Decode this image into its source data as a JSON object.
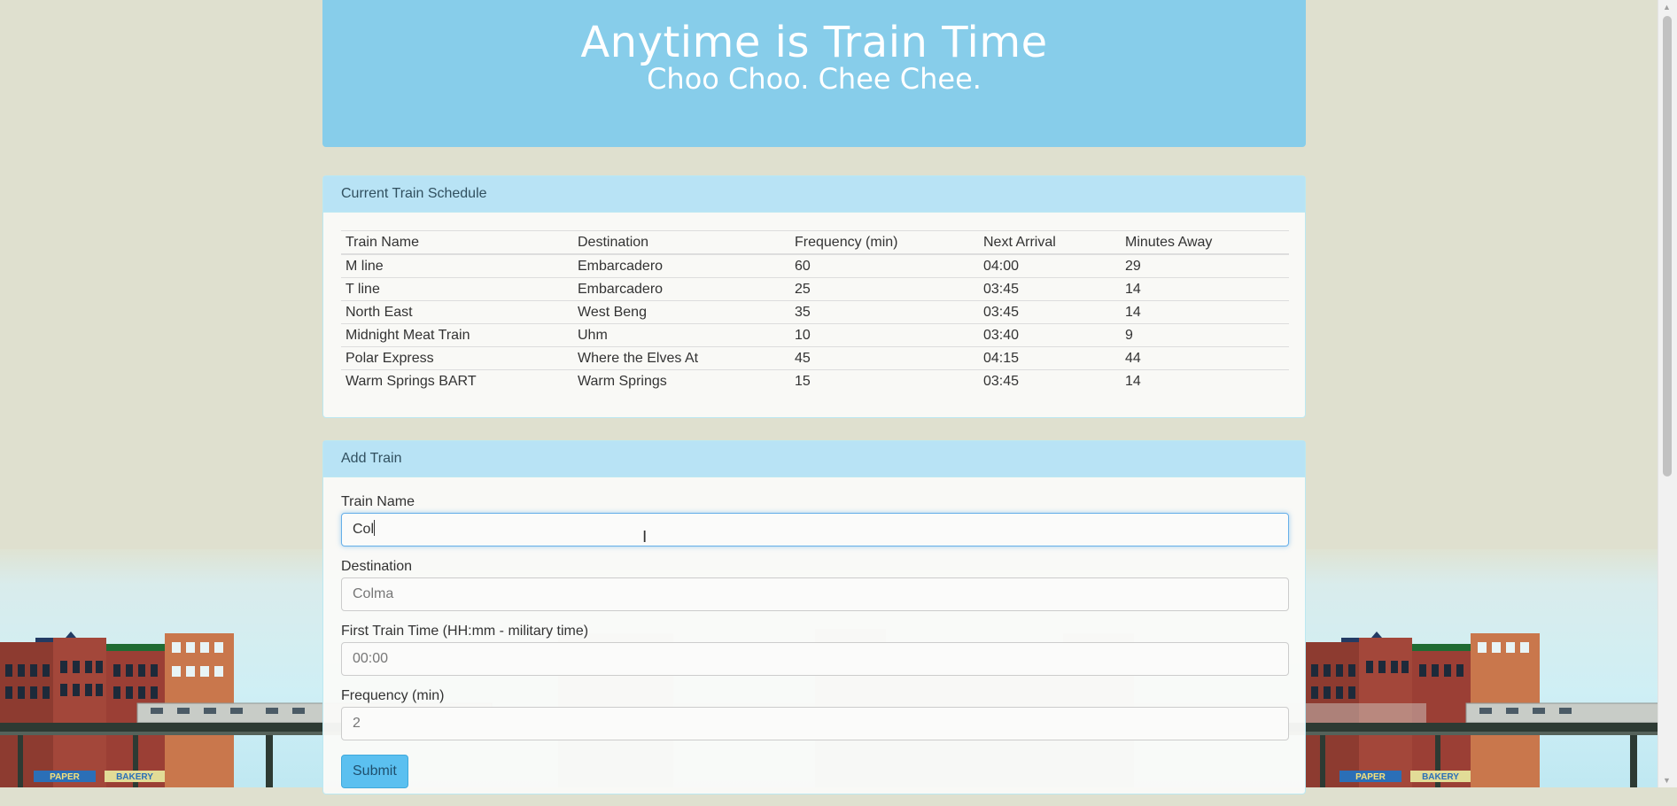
{
  "jumbotron": {
    "title": "Anytime is Train Time",
    "subtitle": "Choo Choo. Chee Chee."
  },
  "schedule": {
    "heading": "Current Train Schedule",
    "columns": [
      "Train Name",
      "Destination",
      "Frequency (min)",
      "Next Arrival",
      "Minutes Away"
    ],
    "rows": [
      [
        "M line",
        "Embarcadero",
        "60",
        "04:00",
        "29"
      ],
      [
        "T line",
        "Embarcadero",
        "25",
        "03:45",
        "14"
      ],
      [
        "North East",
        "West Beng",
        "35",
        "03:45",
        "14"
      ],
      [
        "Midnight Meat Train",
        "Uhm",
        "10",
        "03:40",
        "9"
      ],
      [
        "Polar Express",
        "Where the Elves At",
        "45",
        "04:15",
        "44"
      ],
      [
        "Warm Springs BART",
        "Warm Springs",
        "15",
        "03:45",
        "14"
      ]
    ]
  },
  "add_train": {
    "heading": "Add Train",
    "fields": {
      "train_name": {
        "label": "Train Name",
        "value": "Col",
        "placeholder": ""
      },
      "destination": {
        "label": "Destination",
        "value": "",
        "placeholder": "Colma"
      },
      "first_time": {
        "label": "First Train Time (HH:mm - military time)",
        "value": "",
        "placeholder": "00:00"
      },
      "frequency": {
        "label": "Frequency (min)",
        "value": "",
        "placeholder": "2"
      }
    },
    "submit_label": "Submit"
  },
  "background": {
    "signs": [
      "PAPER",
      "BAKERY"
    ]
  },
  "colors": {
    "page_bg": "#dfe0cf",
    "jumbotron_bg": "#87cdea",
    "panel_heading_bg": "#b8e3f5",
    "submit_bg": "#5bc0f0",
    "building_brick": "#a3473a",
    "elevated_track": "#2d3a33"
  }
}
